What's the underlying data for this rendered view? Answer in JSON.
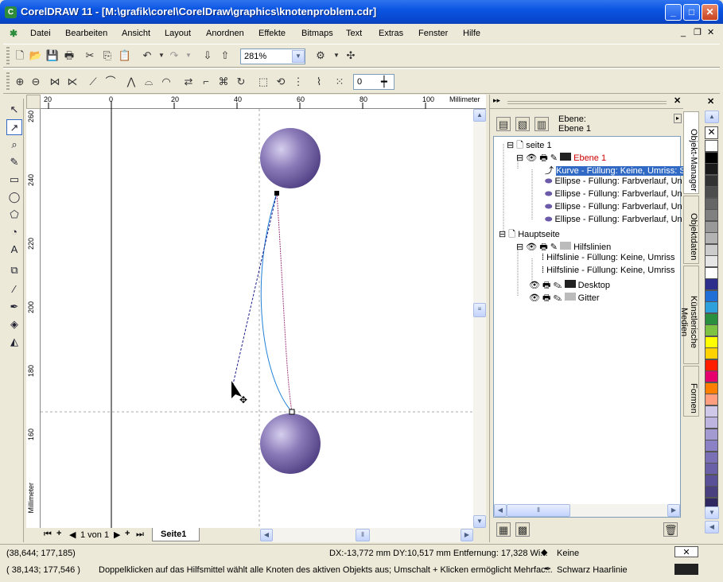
{
  "window": {
    "title": "CorelDRAW 11 - [M:\\grafik\\corel\\CorelDraw\\graphics\\knotenproblem.cdr]"
  },
  "menu": [
    "Datei",
    "Bearbeiten",
    "Ansicht",
    "Layout",
    "Anordnen",
    "Effekte",
    "Bitmaps",
    "Text",
    "Extras",
    "Fenster",
    "Hilfe"
  ],
  "toolbar": {
    "zoom": "281%",
    "nudge_value": "0"
  },
  "ruler": {
    "unit": "Millimeter",
    "h_ticks": [
      "20",
      "0",
      "20",
      "40",
      "60",
      "80",
      "100"
    ],
    "v_ticks": [
      "260",
      "240",
      "220",
      "200",
      "180",
      "160"
    ]
  },
  "pages": {
    "counter": "1 von 1",
    "tab": "Seite1"
  },
  "docker": {
    "layer_label": "Ebene:",
    "layer_name": "Ebene 1",
    "tree": [
      "seite 1",
      "Ebene 1",
      "Kurve - Füllung: Keine, Umriss: S",
      "Ellipse - Füllung: Farbverlauf, Un",
      "Ellipse - Füllung: Farbverlauf, Un",
      "Ellipse - Füllung: Farbverlauf, Un",
      "Ellipse - Füllung: Farbverlauf, Un",
      "Hauptseite",
      "Hilfslinien",
      "Hilfslinie - Füllung: Keine, Umriss",
      "Hilfslinie - Füllung: Keine, Umriss",
      "Desktop",
      "Gitter"
    ],
    "tabs": [
      "Objekt-Manager",
      "Objektdaten",
      "Künstlerische Medien",
      "Formen"
    ]
  },
  "palette": [
    "#ffffff",
    "#000000",
    "#1a1a1a",
    "#333333",
    "#4d4d4d",
    "#666666",
    "#808080",
    "#999999",
    "#b3b3b3",
    "#cccccc",
    "#e6e6e6",
    "#ffffff",
    "#2e2e8c",
    "#1f6fd6",
    "#2ea0dc",
    "#2a8f3e",
    "#7dc242",
    "#ffff00",
    "#ffd200",
    "#ff1e00",
    "#e6006e",
    "#ff7f00",
    "#ff9f80",
    "#d0c8e8",
    "#bdb5e0",
    "#a29ad0",
    "#8a82c4",
    "#7a70b6",
    "#6a60a8",
    "#5a5098",
    "#4a4080",
    "#302860"
  ],
  "status": {
    "coord1": "(38,644; 177,185)",
    "delta": "DX:-13,772 mm DY:10,517 mm Entfernung: 17,328 Wi...",
    "fill_label": "Keine",
    "coord2": "( 38,143; 177,546 )",
    "hint": "Doppelklicken auf das Hilfsmittel wählt alle Knoten des aktiven Objekts aus; Umschalt + Klicken ermöglicht Mehrfac...",
    "outline_label": "Schwarz Haarlinie"
  }
}
